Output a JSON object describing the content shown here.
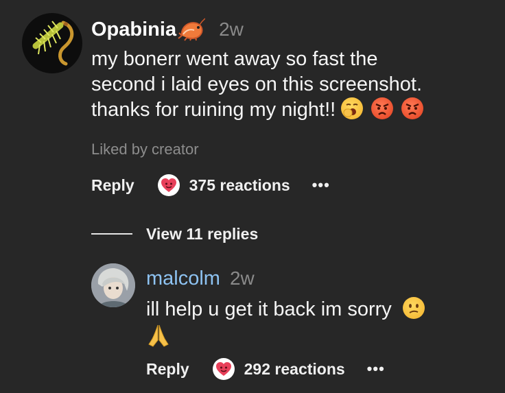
{
  "comment": {
    "username": "Opabinia",
    "time": "2w",
    "text_line1": "my bonerr went away so fast the",
    "text_line2": "second i laid eyes on this screenshot.",
    "text_line3": "thanks for ruining my night!!",
    "liked_by": "Liked by creator",
    "reply_label": "Reply",
    "reactions": "375 reactions",
    "more": "•••"
  },
  "replies_toggle": {
    "label": "View 11 replies"
  },
  "reply": {
    "username": "malcolm",
    "time": "2w",
    "text": "ill help u get it back im sorry",
    "reply_label": "Reply",
    "reactions": "292 reactions",
    "more": "•••"
  },
  "icons": {
    "shrimp": "shrimp-icon",
    "heart": "heart-face-icon",
    "yawn": "yawning-face-icon",
    "angry": "angry-face-icon",
    "confused": "confused-face-icon",
    "pray": "folded-hands-icon"
  },
  "colors": {
    "background": "#272727",
    "reply_username": "#8ec3f2",
    "muted": "#8d8d8d"
  }
}
